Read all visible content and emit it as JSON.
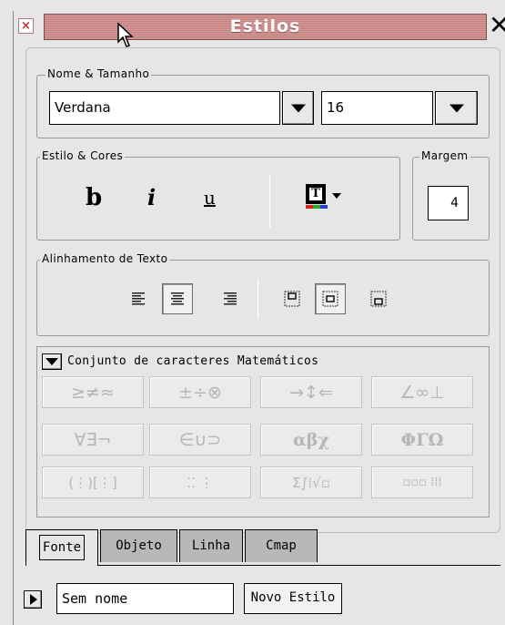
{
  "window": {
    "title": "Estilos"
  },
  "font_group": {
    "label": "Nome & Tamanho",
    "font_value": "Verdana",
    "size_value": "16"
  },
  "style_group": {
    "label": "Estilo & Cores",
    "bold_label": "b",
    "italic_label": "i",
    "underline_label": "u",
    "color_icon_letter": "T"
  },
  "margin_group": {
    "label": "Margem",
    "value": "4"
  },
  "align_group": {
    "label": "Alinhamento de Texto"
  },
  "math_group": {
    "label": "Conjunto de caracteres Matemáticos",
    "rows": [
      [
        "≥≠≈",
        "±÷⊗",
        "→↕⇐",
        "∠∞⊥"
      ],
      [
        "∀∃¬",
        "∈∪⊃",
        "αβχ",
        "ΦΓΩ"
      ],
      [
        "(⋮)[⋮]",
        "⁚⁚  ⋮",
        "Σ∫⁞√▫",
        "▫▫▫ ⁞⁞⁞"
      ]
    ]
  },
  "tabs": [
    "Fonte",
    "Objeto",
    "Linha",
    "Cmap"
  ],
  "bottom": {
    "name_value": "Sem nome",
    "new_style_label": "Novo Estilo"
  }
}
